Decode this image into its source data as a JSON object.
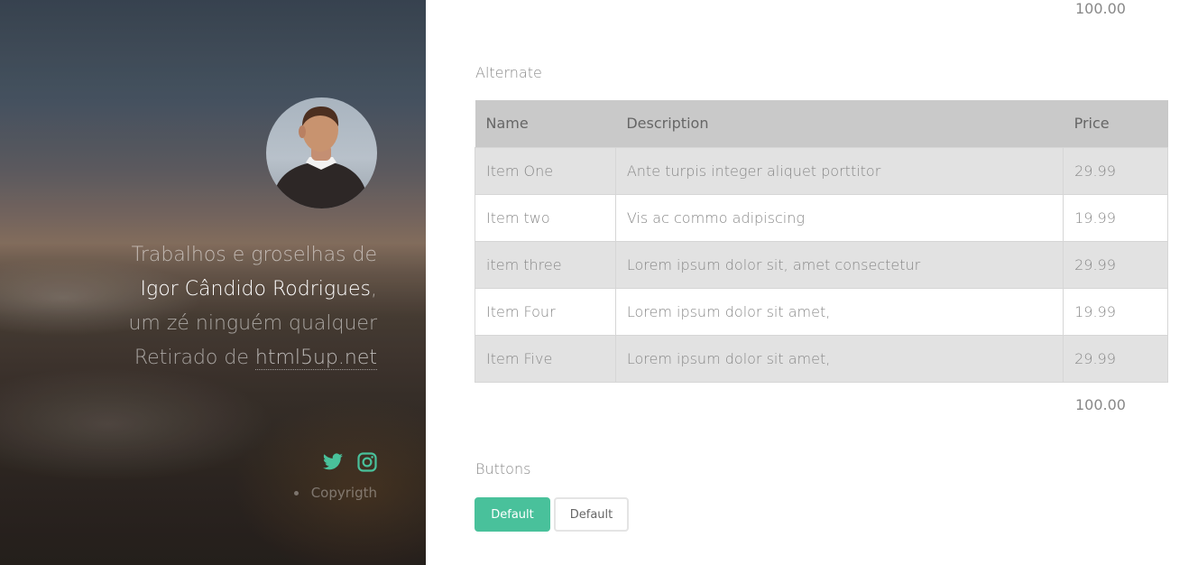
{
  "hero": {
    "intro_line1": "Trabalhos e groselhas de",
    "name": "Igor Cândido Rodrigues",
    "comma": ",",
    "intro_line3": "um zé ninguém qualquer",
    "retirado": "Retirado de",
    "link": "html5up.net",
    "copyright": "Copyrigth",
    "social_icons": [
      "twitter-icon",
      "instagram-icon"
    ],
    "accent_color": "#49c19b"
  },
  "main": {
    "total_top": "100.00",
    "alternate_heading": "Alternate",
    "table": {
      "headers": [
        "Name",
        "Description",
        "Price"
      ],
      "rows": [
        [
          "Item One",
          "Ante turpis integer aliquet porttitor",
          "29.99"
        ],
        [
          "Item two",
          "Vis ac commo adipiscing",
          "19.99"
        ],
        [
          "item three",
          "Lorem ipsum dolor sit, amet consectetur",
          "29.99"
        ],
        [
          "Item Four",
          "Lorem ipsum dolor sit amet,",
          "19.99"
        ],
        [
          "Item Five",
          "Lorem ipsum dolor sit amet,",
          "29.99"
        ]
      ],
      "total": "100.00"
    },
    "buttons_heading": "Buttons",
    "buttons": {
      "primary_label": "Default",
      "default_label": "Default"
    }
  }
}
